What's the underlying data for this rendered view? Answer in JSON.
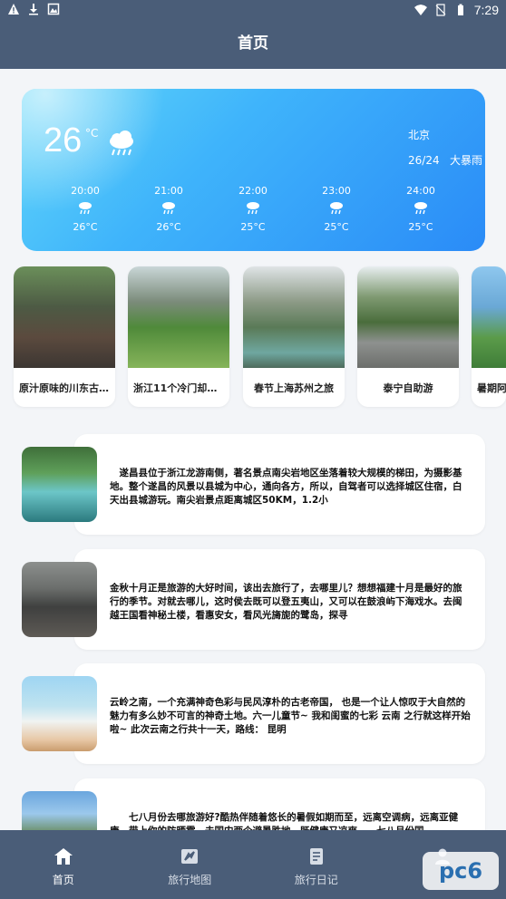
{
  "status_bar": {
    "time": "7:29"
  },
  "header": {
    "title": "首页"
  },
  "weather": {
    "temperature": "26",
    "unit": "°C",
    "city": "北京",
    "date": "26/24",
    "condition": "大暴雨",
    "hourly": [
      {
        "time": "20:00",
        "temp": "26°C"
      },
      {
        "time": "21:00",
        "temp": "26°C"
      },
      {
        "time": "22:00",
        "temp": "25°C"
      },
      {
        "time": "23:00",
        "temp": "25°C"
      },
      {
        "time": "24:00",
        "temp": "25°C"
      }
    ]
  },
  "attractions": [
    {
      "label": "原汁原味的川东古..."
    },
    {
      "label": "浙江11个冷门却超..."
    },
    {
      "label": "春节上海苏州之旅"
    },
    {
      "label": "泰宁自助游"
    },
    {
      "label": "暑期阿"
    }
  ],
  "posts": [
    {
      "text": "　遂昌县位于浙江龙游南侧，著名景点南尖岩地区坐落着较大规模的梯田，为摄影基地。整个遂昌的风景以县城为中心，通向各方，所以，自驾者可以选择城区住宿，白天出县城游玩。南尖岩景点距离城区50KM，1.2小"
    },
    {
      "text": "金秋十月正是旅游的大好时间，该出去旅行了，去哪里儿？想想福建十月是最好的旅行的季节。对就去哪儿，这时侯去既可以登五夷山，又可以在鼓浪屿下海戏水。去闽越王国看神秘土楼，看惠安女，看风光旖旎的鹭岛，探寻"
    },
    {
      "text": "云岭之南，一个充满神奇色彩与民风淳朴的古老帝国， 也是一个让人惊叹于大自然的魅力有多么妙不可言的神奇土地。六一儿童节~ 我和闺蜜的七彩 云南 之行就这样开始啦~ 此次云南之行共十一天，路线： 昆明"
    },
    {
      "text": "　　七八月份去哪旅游好?酷热伴随着悠长的暑假如期而至，远离空调病，远离亚健康，带上你的防晒霜，去国内两个避暑胜地，既健康又凉爽……七八月份国"
    }
  ],
  "tabs": [
    {
      "label": "首页",
      "icon": "home-icon"
    },
    {
      "label": "旅行地图",
      "icon": "map-icon"
    },
    {
      "label": "旅行日记",
      "icon": "diary-icon"
    },
    {
      "label": "",
      "icon": "user-icon"
    }
  ],
  "watermark": "pc6",
  "colors": {
    "header": "#4a5d78",
    "background": "#f3f5f8",
    "weather_gradient_start": "#62d7f8",
    "weather_gradient_end": "#2a8bf7"
  }
}
